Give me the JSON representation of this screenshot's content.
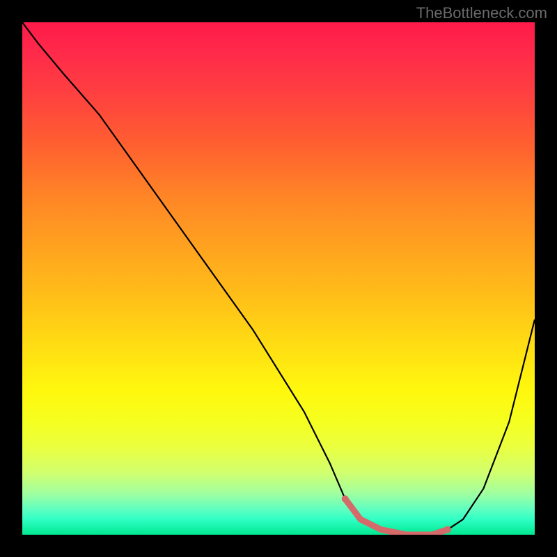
{
  "watermark": "TheBottleneck.com",
  "chart_data": {
    "type": "line",
    "title": "",
    "xlabel": "",
    "ylabel": "",
    "xlim": [
      0,
      100
    ],
    "ylim": [
      0,
      100
    ],
    "gradient_stops": [
      {
        "pos": 0,
        "color": "#ff1a4a"
      },
      {
        "pos": 14,
        "color": "#ff4040"
      },
      {
        "pos": 34,
        "color": "#ff8526"
      },
      {
        "pos": 54,
        "color": "#ffc018"
      },
      {
        "pos": 72,
        "color": "#fff80e"
      },
      {
        "pos": 88,
        "color": "#d0ff70"
      },
      {
        "pos": 100,
        "color": "#00e890"
      }
    ],
    "series": [
      {
        "name": "bottleneck-curve",
        "color": "#000000",
        "x": [
          0,
          3,
          8,
          15,
          25,
          35,
          45,
          55,
          60,
          63,
          66,
          70,
          75,
          80,
          83,
          86,
          90,
          95,
          100
        ],
        "y": [
          100,
          96,
          90,
          82,
          68,
          54,
          40,
          24,
          14,
          7,
          3,
          1,
          0,
          0,
          1,
          3,
          9,
          22,
          42
        ]
      },
      {
        "name": "optimal-range-highlight",
        "color": "#d46a6a",
        "x": [
          63,
          66,
          70,
          75,
          80,
          83
        ],
        "y": [
          7,
          3,
          1,
          0,
          0,
          1
        ]
      }
    ]
  }
}
